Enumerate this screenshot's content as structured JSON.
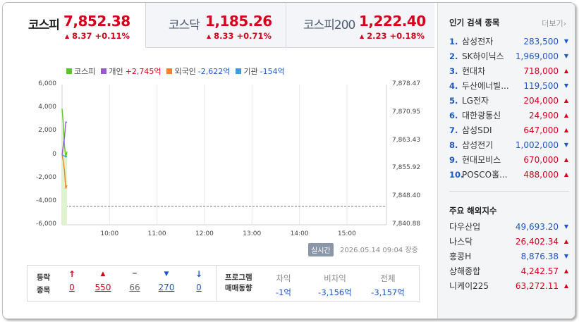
{
  "tabs": [
    {
      "name": "코스피",
      "value": "7,852.38",
      "change": "8.37 +0.11%",
      "direction": "up",
      "active": true
    },
    {
      "name": "코스닥",
      "value": "1,185.26",
      "change": "8.33 +0.71%",
      "direction": "up",
      "active": false
    },
    {
      "name": "코스피200",
      "value": "1,222.40",
      "change": "2.23 +0.18%",
      "direction": "up",
      "active": false
    }
  ],
  "legend": {
    "kospi": {
      "label": "코스피",
      "color": "#5cc528"
    },
    "individual": {
      "label": "개인",
      "value": "+2,745억",
      "color": "#9b59d0"
    },
    "foreign": {
      "label": "외국인",
      "value": "-2,622억",
      "color": "#f0802a"
    },
    "institution": {
      "label": "기관",
      "value": "-154억",
      "color": "#3a9be0"
    }
  },
  "chart_data": {
    "type": "line",
    "x": [
      "09:00",
      "09:01",
      "09:02",
      "09:03",
      "09:04"
    ],
    "left_axis_ticks": [
      "6,000",
      "4,000",
      "2,000",
      "0",
      "-2,000",
      "-4,000",
      "-6,000"
    ],
    "right_axis_ticks": [
      "7,878.47",
      "7,870.95",
      "7,863.43",
      "7,855.92",
      "7,848.40",
      "7,840.88"
    ],
    "x_ticks": [
      "10:00",
      "11:00",
      "12:00",
      "13:00",
      "14:00",
      "15:00"
    ],
    "ylim_left": [
      -6000,
      6000
    ],
    "ylim_right": [
      7840.88,
      7878.47
    ],
    "series": [
      {
        "name": "코스피",
        "axis": "right",
        "values": [
          7872,
          7868,
          7862,
          7859,
          7860.5
        ]
      },
      {
        "name": "개인",
        "values": [
          0,
          800,
          1500,
          2800,
          2745
        ]
      },
      {
        "name": "외국인",
        "values": [
          0,
          -600,
          -1400,
          -2900,
          -2622
        ]
      },
      {
        "name": "기관",
        "values": [
          0,
          -80,
          -120,
          -200,
          -154
        ]
      }
    ],
    "reference_line_right": 7845.8
  },
  "realtime_badge": "실시간",
  "timestamp": "2026.05.14 09:04 장중",
  "stats": {
    "header": [
      "등락",
      "종목"
    ],
    "cols": [
      {
        "symbol": "↑",
        "value": "0",
        "color": "red"
      },
      {
        "symbol": "▲",
        "value": "550",
        "color": "red"
      },
      {
        "symbol": "━",
        "value": "66",
        "color": "gray"
      },
      {
        "symbol": "▼",
        "value": "270",
        "color": "blue"
      },
      {
        "symbol": "↓",
        "value": "0",
        "color": "blue"
      }
    ],
    "program_header": [
      "프로그램",
      "매매동향"
    ],
    "program": [
      {
        "label": "차익",
        "value": "-1억"
      },
      {
        "label": "비차익",
        "value": "-3,156억"
      },
      {
        "label": "전체",
        "value": "-3,157억"
      }
    ]
  },
  "popular": {
    "title": "인기 검색 종목",
    "more": "더보기",
    "items": [
      {
        "rank": "1.",
        "name": "삼성전자",
        "price": "283,500",
        "dir": "down"
      },
      {
        "rank": "2.",
        "name": "SK하이닉스",
        "price": "1,969,000",
        "dir": "down"
      },
      {
        "rank": "3.",
        "name": "현대차",
        "price": "718,000",
        "dir": "up"
      },
      {
        "rank": "4.",
        "name": "두산에너빌...",
        "price": "119,500",
        "dir": "down"
      },
      {
        "rank": "5.",
        "name": "LG전자",
        "price": "204,000",
        "dir": "up"
      },
      {
        "rank": "6.",
        "name": "대한광통신",
        "price": "24,900",
        "dir": "up"
      },
      {
        "rank": "7.",
        "name": "삼성SDI",
        "price": "647,000",
        "dir": "up"
      },
      {
        "rank": "8.",
        "name": "삼성전기",
        "price": "1,002,000",
        "dir": "down"
      },
      {
        "rank": "9.",
        "name": "현대모비스",
        "price": "670,000",
        "dir": "up"
      },
      {
        "rank": "10.",
        "name": "POSCO홀...",
        "price": "488,000",
        "dir": "up"
      }
    ]
  },
  "world": {
    "title": "주요 해외지수",
    "items": [
      {
        "name": "다우산업",
        "price": "49,693.20",
        "dir": "down"
      },
      {
        "name": "나스닥",
        "price": "26,402.34",
        "dir": "up"
      },
      {
        "name": "홍콩H",
        "price": "8,876.38",
        "dir": "down"
      },
      {
        "name": "상해종합",
        "price": "4,242.57",
        "dir": "up"
      },
      {
        "name": "니케이225",
        "price": "63,272.11",
        "dir": "up"
      }
    ]
  },
  "colors": {
    "up": "#d6001c",
    "down": "#1e57c5"
  }
}
